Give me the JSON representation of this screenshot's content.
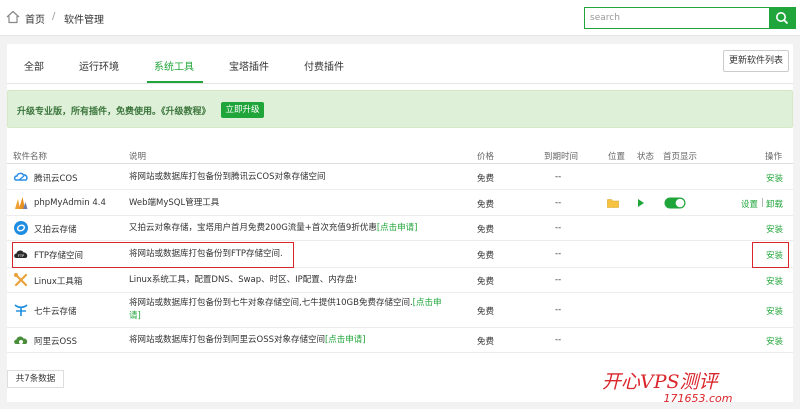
{
  "breadcrumb": {
    "home": "首页",
    "separator": "/",
    "current": "软件管理"
  },
  "search": {
    "placeholder": "search",
    "value": ""
  },
  "tabs": [
    {
      "label": "全部",
      "active": false
    },
    {
      "label": "运行环境",
      "active": false
    },
    {
      "label": "系统工具",
      "active": true
    },
    {
      "label": "宝塔插件",
      "active": false
    },
    {
      "label": "付费插件",
      "active": false
    }
  ],
  "refresh_label": "更新软件列表",
  "promo": {
    "text": "升级专业版，所有插件，免费使用。《升级教程》",
    "button": "立即升级"
  },
  "columns": {
    "name": "软件名称",
    "desc": "说明",
    "price": "价格",
    "expire": "到期时间",
    "location": "位置",
    "status": "状态",
    "home_show": "首页显示",
    "action": "操作"
  },
  "rows": [
    {
      "icon": "tencent-cloud-icon",
      "name": "腾讯云COS",
      "desc": "将网站或数据库打包备份到腾讯云COS对象存储空间",
      "desc_link": "",
      "price": "免费",
      "expire": "--",
      "action": "安装"
    },
    {
      "icon": "phpmyadmin-icon",
      "name": "phpMyAdmin 4.4",
      "desc": "Web端MySQL管理工具",
      "desc_link": "",
      "price": "免费",
      "expire": "--",
      "action_setting": "设置",
      "action_sep": "|",
      "action_uninstall": "卸载"
    },
    {
      "icon": "upyun-icon",
      "name": "又拍云存储",
      "desc": "又拍云对象存储，宝塔用户首月免费200G流量+首次充值9折优惠",
      "desc_link": "[点击申请]",
      "price": "免费",
      "expire": "--",
      "action": "安装"
    },
    {
      "icon": "ftp-icon",
      "name": "FTP存储空间",
      "desc": "将网站或数据库打包备份到FTP存储空间.",
      "desc_link": "",
      "price": "免费",
      "expire": "--",
      "action": "安装"
    },
    {
      "icon": "linux-tools-icon",
      "name": "Linux工具箱",
      "desc": "Linux系统工具，配置DNS、Swap、时区、IP配置、内存盘!",
      "desc_link": "",
      "price": "免费",
      "expire": "--",
      "action": "安装"
    },
    {
      "icon": "qiniu-icon",
      "name": "七牛云存储",
      "desc": "将网站或数据库打包备份到七牛对象存储空间,七牛提供10GB免费存储空间.",
      "desc_link": "[点击申",
      "desc_line2": "请]",
      "price": "免费",
      "expire": "--",
      "action": "安装"
    },
    {
      "icon": "aliyun-oss-icon",
      "name": "阿里云OSS",
      "desc": "将网站或数据库打包备份到阿里云OSS对象存储空间",
      "desc_link": "[点击申请]",
      "price": "免费",
      "expire": "--",
      "action": "安装"
    }
  ],
  "total": "共7条数据",
  "watermark": {
    "text": "开心VPS测评",
    "url": "171653.com"
  },
  "colors": {
    "accent": "#20a53a",
    "highlight": "#d9252b",
    "promo_bg": "#dff0d8"
  }
}
